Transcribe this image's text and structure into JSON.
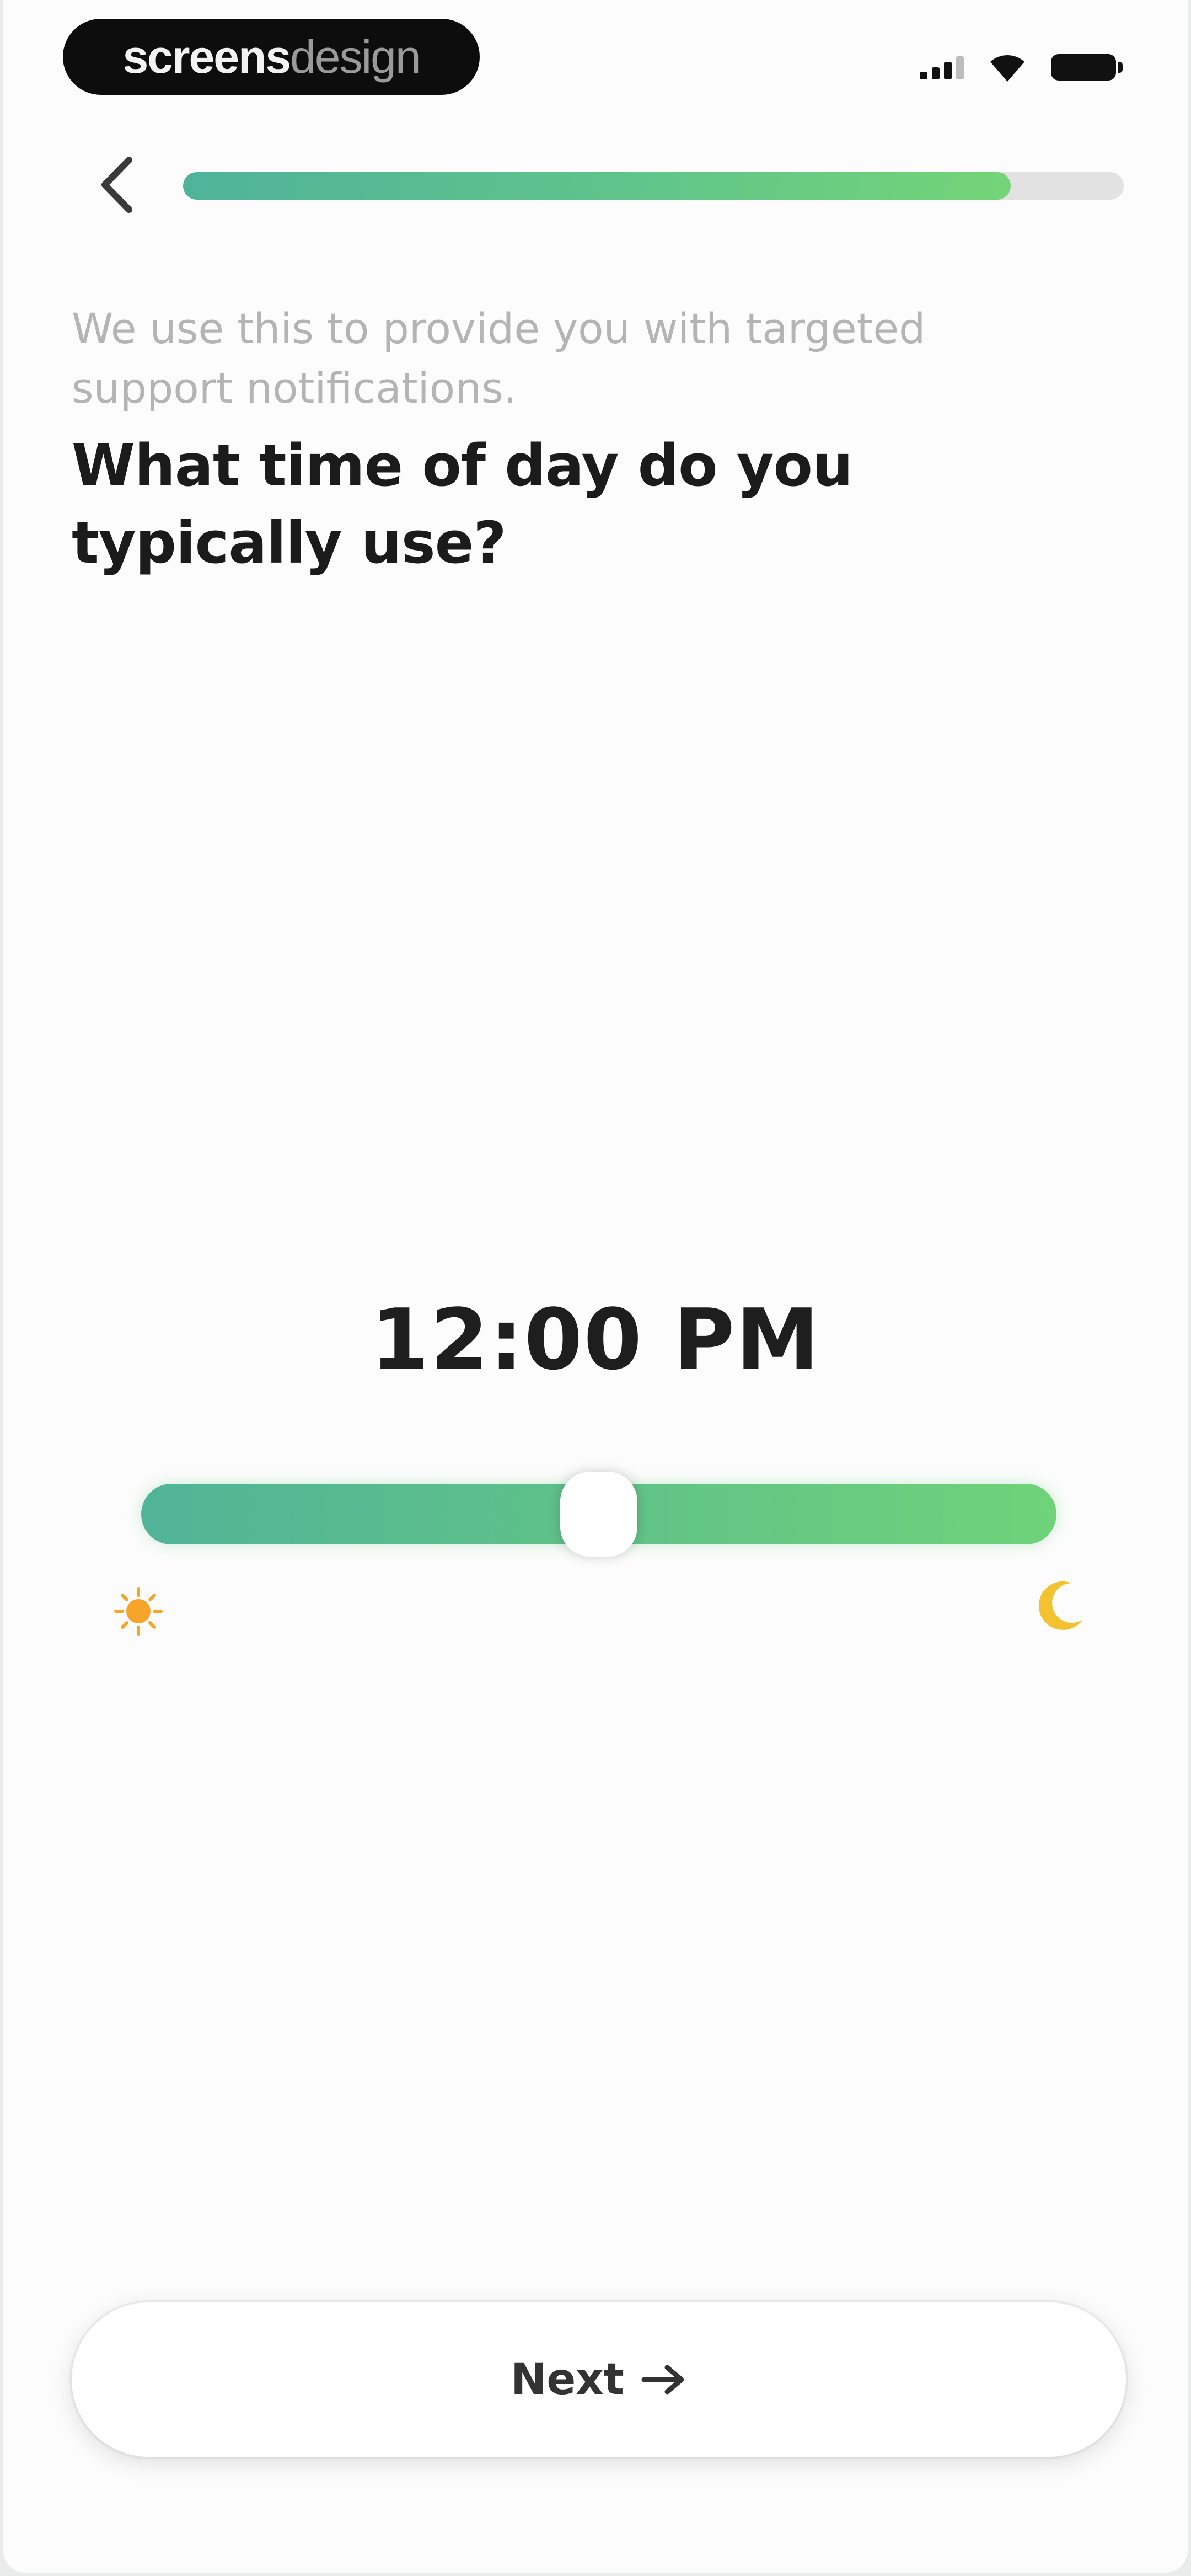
{
  "status_bar": {
    "brand": {
      "bold": "screens",
      "light": "design"
    },
    "icons": [
      "cellular-signal-icon",
      "wifi-icon",
      "battery-icon"
    ]
  },
  "nav": {
    "back_icon": "chevron-left-icon",
    "progress_fraction": 0.88
  },
  "header": {
    "subtitle": "We use this to provide you with targeted support notifications.",
    "title_bold": "What time of day",
    "title_rest": " do you typically use?"
  },
  "time_picker": {
    "value": "12:00 PM",
    "slider_fraction": 0.5,
    "start_icon": "sun-icon",
    "end_icon": "moon-icon"
  },
  "footer": {
    "next_label": "Next",
    "next_icon": "arrow-right-icon"
  },
  "colors": {
    "accent_start": "#4fb39a",
    "accent_end": "#74d477",
    "sun": "#f5a623",
    "moon": "#f2c230"
  }
}
